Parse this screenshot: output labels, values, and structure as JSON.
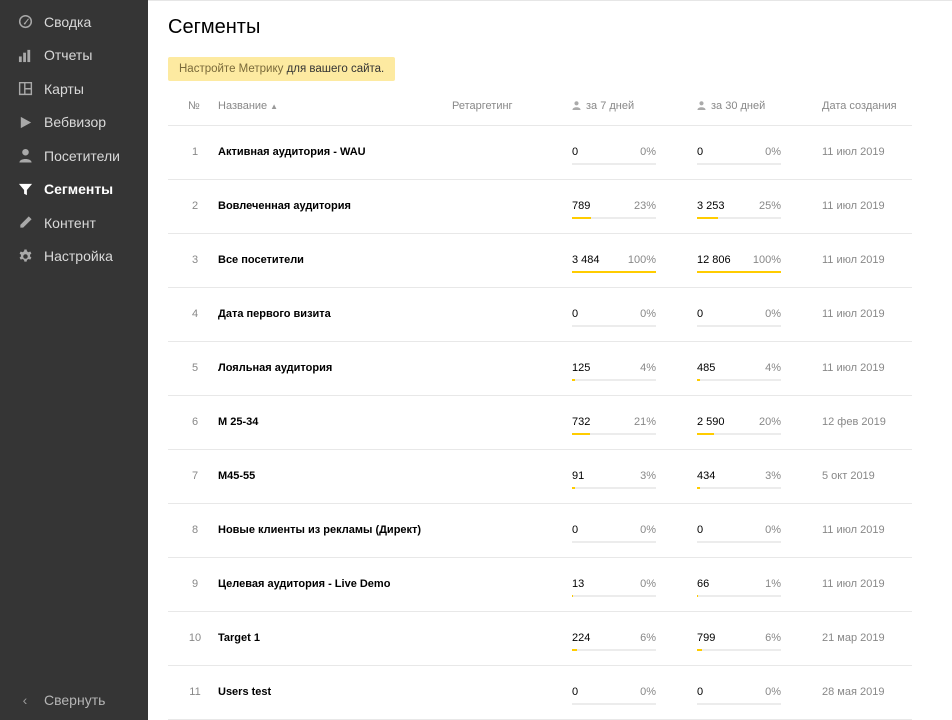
{
  "sidebar": {
    "items": [
      {
        "label": "Сводка",
        "icon": "dashboard-icon",
        "active": false
      },
      {
        "label": "Отчеты",
        "icon": "bar-chart-icon",
        "active": false
      },
      {
        "label": "Карты",
        "icon": "map-icon",
        "active": false
      },
      {
        "label": "Вебвизор",
        "icon": "play-icon",
        "active": false
      },
      {
        "label": "Посетители",
        "icon": "user-icon",
        "active": false
      },
      {
        "label": "Сегменты",
        "icon": "filter-icon",
        "active": true
      },
      {
        "label": "Контент",
        "icon": "pencil-icon",
        "active": false
      },
      {
        "label": "Настройка",
        "icon": "gear-icon",
        "active": false
      }
    ],
    "collapse_label": "Свернуть"
  },
  "page": {
    "title": "Сегменты",
    "notice_link": "Настройте Метрику",
    "notice_text": " для вашего сайта."
  },
  "table": {
    "headers": {
      "num": "№",
      "name": "Название",
      "retargeting": "Ретаргетинг",
      "week": "за 7 дней",
      "month": "за 30 дней",
      "created": "Дата создания"
    },
    "rows": [
      {
        "num": "1",
        "name": "Активная аудитория - WAU",
        "v7": "0",
        "p7": "0%",
        "f7": 0,
        "v30": "0",
        "p30": "0%",
        "f30": 0,
        "date": "11 июл 2019"
      },
      {
        "num": "2",
        "name": "Вовлеченная аудитория",
        "v7": "789",
        "p7": "23%",
        "f7": 23,
        "v30": "3 253",
        "p30": "25%",
        "f30": 25,
        "date": "11 июл 2019"
      },
      {
        "num": "3",
        "name": "Все посетители",
        "v7": "3 484",
        "p7": "100%",
        "f7": 100,
        "v30": "12 806",
        "p30": "100%",
        "f30": 100,
        "date": "11 июл 2019"
      },
      {
        "num": "4",
        "name": "Дата первого визита",
        "v7": "0",
        "p7": "0%",
        "f7": 0,
        "v30": "0",
        "p30": "0%",
        "f30": 0,
        "date": "11 июл 2019"
      },
      {
        "num": "5",
        "name": "Лояльная аудитория",
        "v7": "125",
        "p7": "4%",
        "f7": 4,
        "v30": "485",
        "p30": "4%",
        "f30": 4,
        "date": "11 июл 2019"
      },
      {
        "num": "6",
        "name": "М 25-34",
        "v7": "732",
        "p7": "21%",
        "f7": 21,
        "v30": "2 590",
        "p30": "20%",
        "f30": 20,
        "date": "12 фев 2019"
      },
      {
        "num": "7",
        "name": "М45-55",
        "v7": "91",
        "p7": "3%",
        "f7": 3,
        "v30": "434",
        "p30": "3%",
        "f30": 3,
        "date": "5 окт 2019"
      },
      {
        "num": "8",
        "name": "Новые клиенты из рекламы (Директ)",
        "v7": "0",
        "p7": "0%",
        "f7": 0,
        "v30": "0",
        "p30": "0%",
        "f30": 0,
        "date": "11 июл 2019"
      },
      {
        "num": "9",
        "name": "Целевая аудитория - Live Demo",
        "v7": "13",
        "p7": "0%",
        "f7": 0.4,
        "v30": "66",
        "p30": "1%",
        "f30": 1,
        "date": "11 июл 2019"
      },
      {
        "num": "10",
        "name": "Target 1",
        "v7": "224",
        "p7": "6%",
        "f7": 6,
        "v30": "799",
        "p30": "6%",
        "f30": 6,
        "date": "21 мар 2019"
      },
      {
        "num": "11",
        "name": "Users test",
        "v7": "0",
        "p7": "0%",
        "f7": 0,
        "v30": "0",
        "p30": "0%",
        "f30": 0,
        "date": "28 мая 2019"
      }
    ]
  },
  "colors": {
    "sidebar_bg": "#353535",
    "accent": "#ffcc00",
    "notice_bg": "#fdeaa1"
  }
}
